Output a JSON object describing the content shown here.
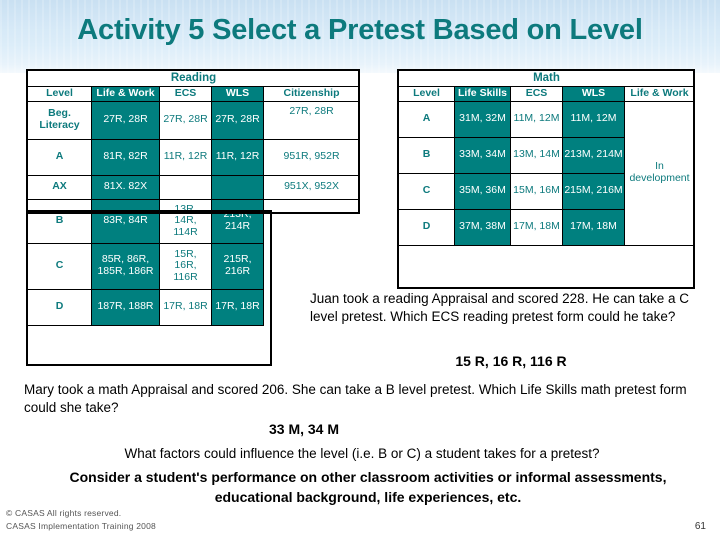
{
  "slide": {
    "title": "Activity 5 Select a Pretest Based on Level",
    "title_color": "#0d7a7d",
    "teal_fill": "#00807f",
    "banner_color": "#d6e9f7",
    "page_number": "61"
  },
  "reading_table": {
    "caption": "Reading",
    "columns": [
      "Level",
      "Life & Work",
      "ECS",
      "WLS",
      "Citizenship"
    ],
    "rows": [
      {
        "level": "Beg. Literacy",
        "life_work": "27R, 28R",
        "ecs": "27R, 28R",
        "wls": "27R, 28R",
        "citizenship": "27R, 28R"
      },
      {
        "level": "A",
        "life_work": "81R, 82R",
        "ecs": "11R, 12R",
        "wls": "11R, 12R",
        "citizenship": "951R, 952R"
      },
      {
        "level": "AX",
        "life_work": "81X. 82X",
        "ecs": "",
        "wls": "",
        "citizenship": "951X, 952X"
      },
      {
        "level": "B",
        "life_work": "83R, 84R",
        "ecs": "13R, 14R, 114R",
        "wls": "213R, 214R",
        "citizenship": ""
      },
      {
        "level": "C",
        "life_work": "85R, 86R, 185R, 186R",
        "ecs": "15R, 16R, 116R",
        "wls": "215R, 216R",
        "citizenship": ""
      },
      {
        "level": "D",
        "life_work": "187R, 188R",
        "ecs": "17R, 18R",
        "wls": "17R, 18R",
        "citizenship": ""
      }
    ]
  },
  "math_table": {
    "caption": "Math",
    "columns": [
      "Level",
      "Life Skills",
      "ECS",
      "WLS",
      "Life & Work"
    ],
    "life_work_note": "In development",
    "rows": [
      {
        "level": "A",
        "life_skills": "31M, 32M",
        "ecs": "11M, 12M",
        "wls": "11M, 12M"
      },
      {
        "level": "B",
        "life_skills": "33M, 34M",
        "ecs": "13M, 14M",
        "wls": "213M, 214M"
      },
      {
        "level": "C",
        "life_skills": "35M, 36M",
        "ecs": "15M, 16M",
        "wls": "215M, 216M"
      },
      {
        "level": "D",
        "life_skills": "37M, 38M",
        "ecs": "17M, 18M",
        "wls": "17M, 18M"
      }
    ]
  },
  "questions": {
    "juan_question": "Juan took a reading Appraisal and scored 228. He can take a C level pretest. Which ECS reading pretest form could he take?",
    "juan_answer": "15 R, 16 R, 116 R",
    "mary_question": "Mary took a math Appraisal and scored 206. She can take a B level pretest. Which Life Skills math pretest form could she take?",
    "mary_answer": "33 M, 34 M",
    "factors_question": "What factors could influence the level (i.e. B or C) a student takes for a pretest?",
    "factors_answer": "Consider a student's performance on other classroom activities or informal assessments, educational background, life experiences, etc."
  },
  "footer": {
    "line1": "© CASAS All rights reserved.",
    "line2": "CASAS Implementation Training 2008"
  }
}
